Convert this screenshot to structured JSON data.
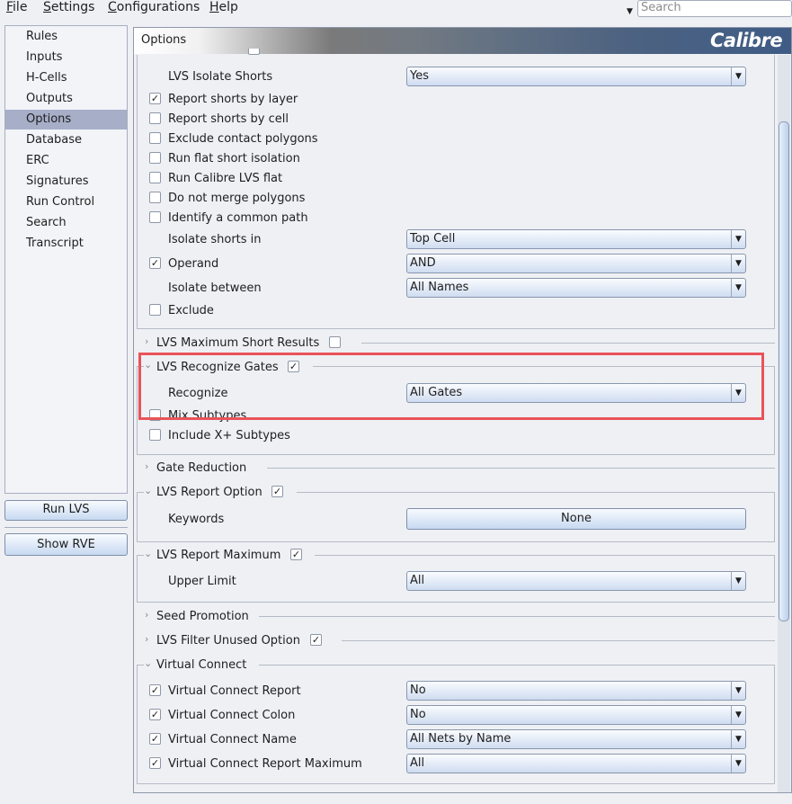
{
  "menubar": {
    "items": [
      "File",
      "Settings",
      "Configurations",
      "Help"
    ],
    "underline": [
      "F",
      "S",
      "C",
      "H"
    ],
    "rest": [
      "ile",
      "ettings",
      "onfigurations",
      "elp"
    ],
    "search_placeholder": "Search"
  },
  "sidebar": {
    "items": [
      "Rules",
      "Inputs",
      "H-Cells",
      "Outputs",
      "Options",
      "Database",
      "ERC",
      "Signatures",
      "Run Control",
      "Search",
      "Transcript"
    ],
    "selected": "Options",
    "run_lvs": "Run LVS",
    "show_rve": "Show RVE"
  },
  "panel": {
    "title": "Options",
    "logo": "Calibre"
  },
  "shorts": {
    "isolate_shorts_label": "LVS Isolate Shorts",
    "isolate_shorts_value": "Yes",
    "report_by_layer": "Report shorts by layer",
    "report_by_cell": "Report shorts by cell",
    "exclude_contact": "Exclude contact polygons",
    "run_flat_isolation": "Run flat short isolation",
    "run_calibre_flat": "Run Calibre LVS flat",
    "no_merge": "Do not merge polygons",
    "common_path": "Identify a common path",
    "isolate_in_label": "Isolate shorts in",
    "isolate_in_value": "Top Cell",
    "operand_label": "Operand",
    "operand_value": "AND",
    "isolate_between_label": "Isolate between",
    "isolate_between_value": "All Names",
    "exclude": "Exclude"
  },
  "max_short": {
    "label": "LVS Maximum Short Results"
  },
  "recognize_gates": {
    "label": "LVS Recognize Gates",
    "recognize_label": "Recognize",
    "recognize_value": "All Gates",
    "mix_subtypes": "Mix Subtypes",
    "include_x_subtypes": "Include X+ Subtypes"
  },
  "gate_reduction": {
    "label": "Gate Reduction"
  },
  "report_option": {
    "label": "LVS Report Option",
    "keywords_label": "Keywords",
    "keywords_value": "None"
  },
  "report_maximum": {
    "label": "LVS Report Maximum",
    "upper_limit_label": "Upper Limit",
    "upper_limit_value": "All"
  },
  "seed_promotion": {
    "label": "Seed Promotion"
  },
  "filter_unused": {
    "label": "LVS Filter Unused Option"
  },
  "virtual_connect": {
    "label": "Virtual Connect",
    "report_label": "Virtual Connect Report",
    "report_value": "No",
    "colon_label": "Virtual Connect Colon",
    "colon_value": "No",
    "name_label": "Virtual Connect Name",
    "name_value": "All Nets by Name",
    "report_max_label": "Virtual Connect Report Maximum",
    "report_max_value": "All"
  },
  "glyphs": {
    "check": "✓",
    "chevron_right": "›",
    "chevron_down": "⌄",
    "combo_arrow": "▼"
  }
}
